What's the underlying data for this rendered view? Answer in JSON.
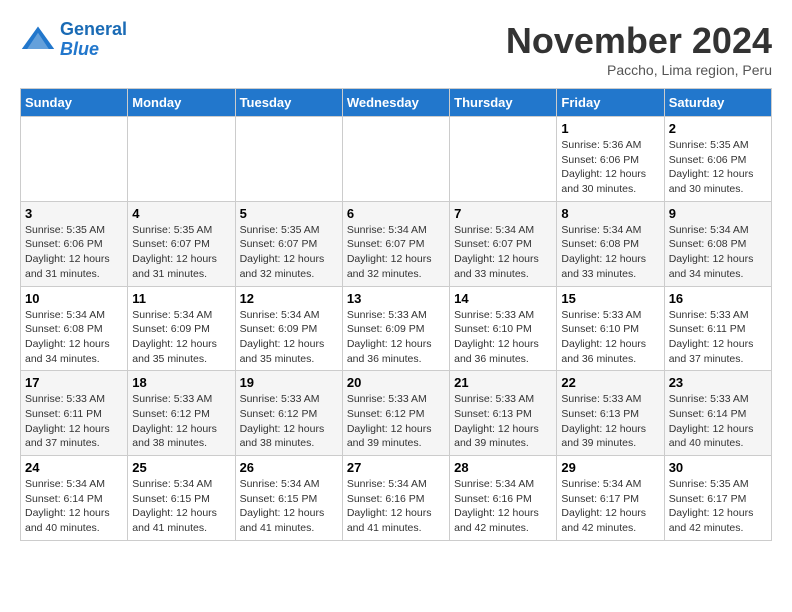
{
  "header": {
    "logo_line1": "General",
    "logo_line2": "Blue",
    "month": "November 2024",
    "location": "Paccho, Lima region, Peru"
  },
  "days_of_week": [
    "Sunday",
    "Monday",
    "Tuesday",
    "Wednesday",
    "Thursday",
    "Friday",
    "Saturday"
  ],
  "weeks": [
    [
      {
        "day": "",
        "info": ""
      },
      {
        "day": "",
        "info": ""
      },
      {
        "day": "",
        "info": ""
      },
      {
        "day": "",
        "info": ""
      },
      {
        "day": "",
        "info": ""
      },
      {
        "day": "1",
        "info": "Sunrise: 5:36 AM\nSunset: 6:06 PM\nDaylight: 12 hours and 30 minutes."
      },
      {
        "day": "2",
        "info": "Sunrise: 5:35 AM\nSunset: 6:06 PM\nDaylight: 12 hours and 30 minutes."
      }
    ],
    [
      {
        "day": "3",
        "info": "Sunrise: 5:35 AM\nSunset: 6:06 PM\nDaylight: 12 hours and 31 minutes."
      },
      {
        "day": "4",
        "info": "Sunrise: 5:35 AM\nSunset: 6:07 PM\nDaylight: 12 hours and 31 minutes."
      },
      {
        "day": "5",
        "info": "Sunrise: 5:35 AM\nSunset: 6:07 PM\nDaylight: 12 hours and 32 minutes."
      },
      {
        "day": "6",
        "info": "Sunrise: 5:34 AM\nSunset: 6:07 PM\nDaylight: 12 hours and 32 minutes."
      },
      {
        "day": "7",
        "info": "Sunrise: 5:34 AM\nSunset: 6:07 PM\nDaylight: 12 hours and 33 minutes."
      },
      {
        "day": "8",
        "info": "Sunrise: 5:34 AM\nSunset: 6:08 PM\nDaylight: 12 hours and 33 minutes."
      },
      {
        "day": "9",
        "info": "Sunrise: 5:34 AM\nSunset: 6:08 PM\nDaylight: 12 hours and 34 minutes."
      }
    ],
    [
      {
        "day": "10",
        "info": "Sunrise: 5:34 AM\nSunset: 6:08 PM\nDaylight: 12 hours and 34 minutes."
      },
      {
        "day": "11",
        "info": "Sunrise: 5:34 AM\nSunset: 6:09 PM\nDaylight: 12 hours and 35 minutes."
      },
      {
        "day": "12",
        "info": "Sunrise: 5:34 AM\nSunset: 6:09 PM\nDaylight: 12 hours and 35 minutes."
      },
      {
        "day": "13",
        "info": "Sunrise: 5:33 AM\nSunset: 6:09 PM\nDaylight: 12 hours and 36 minutes."
      },
      {
        "day": "14",
        "info": "Sunrise: 5:33 AM\nSunset: 6:10 PM\nDaylight: 12 hours and 36 minutes."
      },
      {
        "day": "15",
        "info": "Sunrise: 5:33 AM\nSunset: 6:10 PM\nDaylight: 12 hours and 36 minutes."
      },
      {
        "day": "16",
        "info": "Sunrise: 5:33 AM\nSunset: 6:11 PM\nDaylight: 12 hours and 37 minutes."
      }
    ],
    [
      {
        "day": "17",
        "info": "Sunrise: 5:33 AM\nSunset: 6:11 PM\nDaylight: 12 hours and 37 minutes."
      },
      {
        "day": "18",
        "info": "Sunrise: 5:33 AM\nSunset: 6:12 PM\nDaylight: 12 hours and 38 minutes."
      },
      {
        "day": "19",
        "info": "Sunrise: 5:33 AM\nSunset: 6:12 PM\nDaylight: 12 hours and 38 minutes."
      },
      {
        "day": "20",
        "info": "Sunrise: 5:33 AM\nSunset: 6:12 PM\nDaylight: 12 hours and 39 minutes."
      },
      {
        "day": "21",
        "info": "Sunrise: 5:33 AM\nSunset: 6:13 PM\nDaylight: 12 hours and 39 minutes."
      },
      {
        "day": "22",
        "info": "Sunrise: 5:33 AM\nSunset: 6:13 PM\nDaylight: 12 hours and 39 minutes."
      },
      {
        "day": "23",
        "info": "Sunrise: 5:33 AM\nSunset: 6:14 PM\nDaylight: 12 hours and 40 minutes."
      }
    ],
    [
      {
        "day": "24",
        "info": "Sunrise: 5:34 AM\nSunset: 6:14 PM\nDaylight: 12 hours and 40 minutes."
      },
      {
        "day": "25",
        "info": "Sunrise: 5:34 AM\nSunset: 6:15 PM\nDaylight: 12 hours and 41 minutes."
      },
      {
        "day": "26",
        "info": "Sunrise: 5:34 AM\nSunset: 6:15 PM\nDaylight: 12 hours and 41 minutes."
      },
      {
        "day": "27",
        "info": "Sunrise: 5:34 AM\nSunset: 6:16 PM\nDaylight: 12 hours and 41 minutes."
      },
      {
        "day": "28",
        "info": "Sunrise: 5:34 AM\nSunset: 6:16 PM\nDaylight: 12 hours and 42 minutes."
      },
      {
        "day": "29",
        "info": "Sunrise: 5:34 AM\nSunset: 6:17 PM\nDaylight: 12 hours and 42 minutes."
      },
      {
        "day": "30",
        "info": "Sunrise: 5:35 AM\nSunset: 6:17 PM\nDaylight: 12 hours and 42 minutes."
      }
    ]
  ]
}
